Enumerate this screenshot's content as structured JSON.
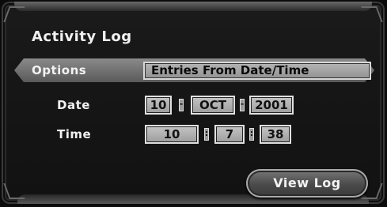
{
  "window": {
    "title": "Activity Log"
  },
  "options": {
    "label": "Options",
    "value": "Entries From Date/Time"
  },
  "date": {
    "label": "Date",
    "day": "10",
    "month": "OCT",
    "year": "2001"
  },
  "time": {
    "label": "Time",
    "hour": "10",
    "minute": "7",
    "second": "38"
  },
  "actions": {
    "view_log_label": "View Log"
  },
  "colors": {
    "background": "#121212",
    "panel_highlight": "#8a8a8a",
    "field": "#b0b0b0"
  }
}
